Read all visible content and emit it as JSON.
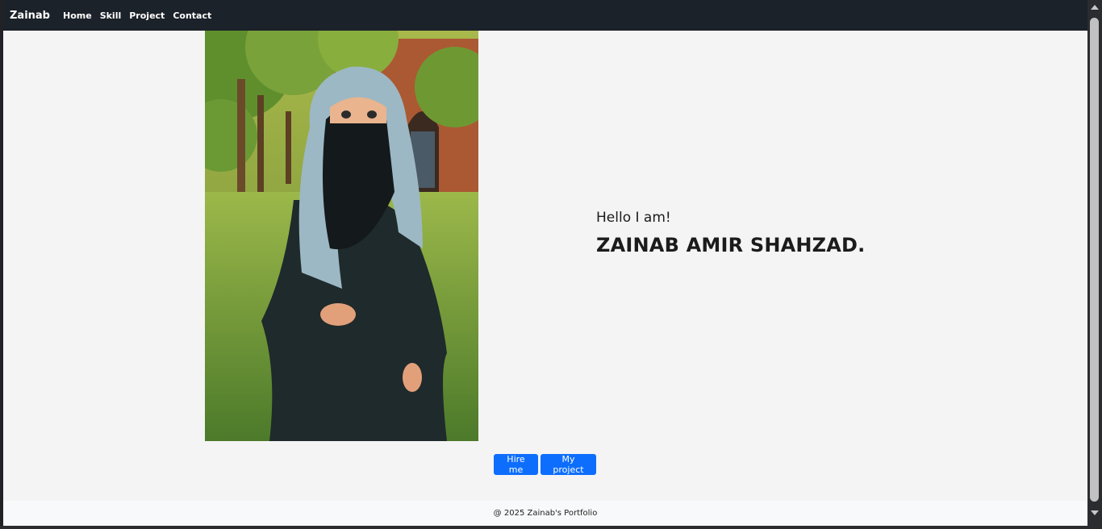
{
  "navbar": {
    "brand": "Zainab",
    "links": [
      "Home",
      "Skill",
      "Project",
      "Contact"
    ]
  },
  "hero": {
    "greeting": "Hello I am!",
    "name": "ZAINAB AMIR SHAHZAD.",
    "image_alt": "Illustration of a girl wearing a hijab and niqab standing in a garden"
  },
  "buttons": {
    "hire": "Hire me",
    "project": "My project"
  },
  "footer": {
    "text": "@ 2025 Zainab's Portfolio"
  },
  "colors": {
    "navbar_bg": "#1c2229",
    "page_bg": "#f4f4f4",
    "button_primary": "#0d6efd"
  }
}
